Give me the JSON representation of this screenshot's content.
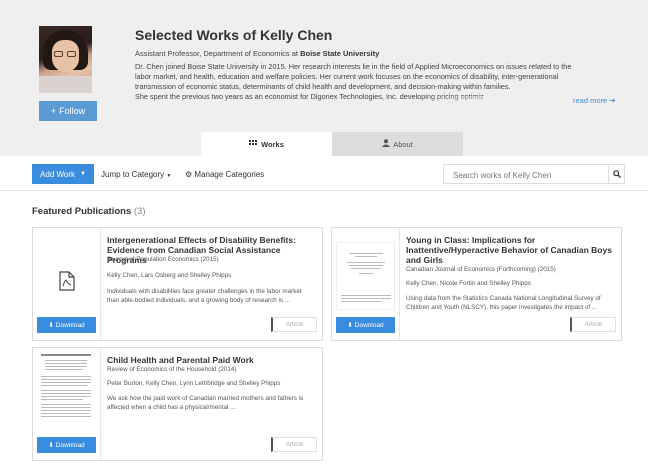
{
  "profile": {
    "name": "Selected Works of Kelly Chen",
    "position_prefix": "Assistant Professor, Department of Economics at ",
    "institution": "Boise State University",
    "bio_lines": [
      "Dr. Chen joined Boise State University in 2015. Her research interests lie in the field of Applied Microeconomics on issues related to the",
      "labor market, and health, education and welfare policies. Her current work focuses on the economics of disability, inter-generational",
      "transmission of economic status, determinants of child health and development, and decision-making within families.",
      "She spent the previous two years as an economist for Digonex Technologies, Inc. developing pricing optimiz"
    ],
    "read_more": "read more",
    "follow_label": "Follow"
  },
  "tabs": {
    "works": "Works",
    "about": "About"
  },
  "toolbar": {
    "add_work": "Add Work",
    "jump": "Jump to Category",
    "manage": "Manage Categories",
    "search_placeholder": "Search works of Kelly Chen"
  },
  "section": {
    "title": "Featured Publications",
    "count": "(3)"
  },
  "publications": [
    {
      "title_lines": [
        "Intergenerational Effects of Disability Benefits:",
        "Evidence from Canadian Social Assistance Programs"
      ],
      "journal": "Journal of Population Economics (2015)",
      "authors": "Kelly Chen, Lars Osberg and Shelley Phipps",
      "abstract_lines": [
        "Individuals with disabilities face greater challenges in the labor market",
        "than able-bodied individuals, and a growing body of research is ..."
      ],
      "download": "Download",
      "type": "Article"
    },
    {
      "title_lines": [
        "Young in Class: Implications for",
        "Inattentive/Hyperactive Behavior of Canadian Boys",
        "and Girls"
      ],
      "journal": "Canadian Journal of Economics (Forthcoming) (2015)",
      "authors": "Kelly Chen, Nicole Fortin and Shelley Phipps",
      "abstract_lines": [
        "Using data from the Statistics Canada National Longitudinal Survey of",
        "Children and Youth (NLSCY), this paper investigates the impact of ..."
      ],
      "download": "Download",
      "type": "Article"
    },
    {
      "title_lines": [
        "Child Health and Parental Paid Work"
      ],
      "journal": "Review of Economics of the Household (2014)",
      "authors": "Peter Burton, Kelly Chen, Lynn Lethbridge and Shelley Phipps",
      "abstract_lines": [
        "We ask how the paid work of Canadian married mothers and fathers is",
        "affected when a child has a physical/mental ..."
      ],
      "download": "Download",
      "type": "Article"
    }
  ],
  "colors": {
    "primary": "#3a8dde",
    "follow": "#5b9bd5",
    "header_bg": "#efefef"
  }
}
